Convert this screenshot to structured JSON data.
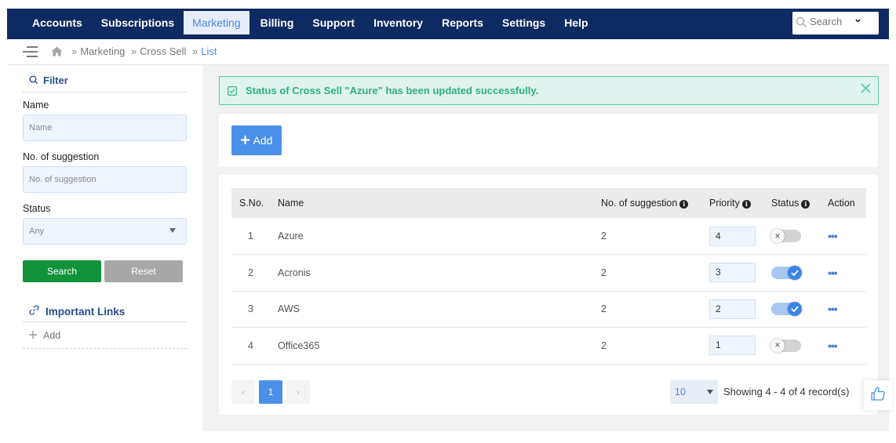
{
  "nav": {
    "items": [
      "Accounts",
      "Subscriptions",
      "Marketing",
      "Billing",
      "Support",
      "Inventory",
      "Reports",
      "Settings",
      "Help"
    ],
    "active": "Marketing",
    "search_placeholder": "Search"
  },
  "breadcrumb": {
    "items": [
      "Marketing",
      "Cross Sell",
      "List"
    ],
    "separator": "»"
  },
  "filter": {
    "title": "Filter",
    "name_label": "Name",
    "name_placeholder": "Name",
    "suggestion_label": "No. of suggestion",
    "suggestion_placeholder": "No. of suggestion",
    "status_label": "Status",
    "status_value": "Any",
    "search_button": "Search",
    "reset_button": "Reset"
  },
  "links": {
    "title": "Important Links",
    "add_label": "Add"
  },
  "alert": {
    "message": "Status of Cross Sell \"Azure\" has been updated successfully."
  },
  "toolbar": {
    "add_label": "Add"
  },
  "table": {
    "headers": {
      "sno": "S.No.",
      "name": "Name",
      "suggestions": "No. of suggestion",
      "priority": "Priority",
      "status": "Status",
      "action": "Action"
    },
    "rows": [
      {
        "sno": "1",
        "name": "Azure",
        "suggestions": "2",
        "priority": "4",
        "status": false
      },
      {
        "sno": "2",
        "name": "Acronis",
        "suggestions": "2",
        "priority": "3",
        "status": true
      },
      {
        "sno": "3",
        "name": "AWS",
        "suggestions": "2",
        "priority": "2",
        "status": true
      },
      {
        "sno": "4",
        "name": "Office365",
        "suggestions": "2",
        "priority": "1",
        "status": false
      }
    ]
  },
  "pagination": {
    "current_page": "1",
    "per_page": "10",
    "summary": "Showing 4 - 4 of 4 record(s)"
  },
  "colors": {
    "nav_bg": "#0e2a63",
    "accent": "#4a90e9",
    "success": "#2fae86",
    "search_button": "#10933b"
  }
}
